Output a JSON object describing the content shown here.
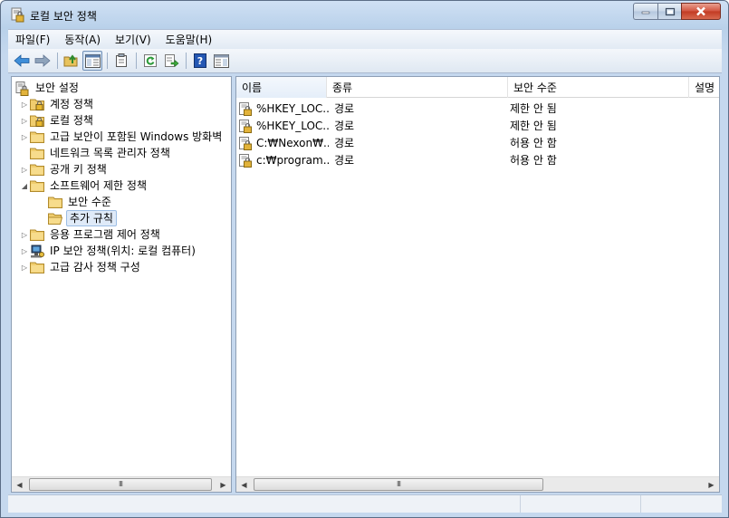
{
  "window": {
    "title": "로컬 보안 정책",
    "icon": "security-policy-icon"
  },
  "menu": [
    "파일(F)",
    "동작(A)",
    "보기(V)",
    "도움말(H)"
  ],
  "toolbar": {
    "buttons": [
      "back-arrow-icon",
      "forward-arrow-icon",
      "up-folder-icon",
      "show-hide-tree-icon",
      "properties-icon",
      "refresh-icon",
      "export-list-icon",
      "help-icon",
      "show-hide-action-pane-icon"
    ]
  },
  "tree": {
    "root": "보안 설정",
    "items": [
      {
        "label": "계정 정책",
        "expander": "▷",
        "icon": "lock-folder-icon"
      },
      {
        "label": "로컬 정책",
        "expander": "▷",
        "icon": "lock-folder-icon"
      },
      {
        "label": "고급 보안이 포함된 Windows 방화벽",
        "expander": "▷",
        "icon": "folder-icon"
      },
      {
        "label": "네트워크 목록 관리자 정책",
        "expander": "",
        "icon": "folder-icon"
      },
      {
        "label": "공개 키 정책",
        "expander": "▷",
        "icon": "folder-icon"
      },
      {
        "label": "소프트웨어 제한 정책",
        "expander": "◢",
        "icon": "folder-icon"
      },
      {
        "label": "보안 수준",
        "expander": "",
        "icon": "folder-icon"
      },
      {
        "label": "추가 규칙",
        "expander": "",
        "icon": "folder-open-icon",
        "selected": true
      },
      {
        "label": "응용 프로그램 제어 정책",
        "expander": "▷",
        "icon": "folder-icon"
      },
      {
        "label": "IP 보안 정책(위치: 로컬 컴퓨터)",
        "expander": "▷",
        "icon": "network-policy-icon"
      },
      {
        "label": "고급 감사 정책 구성",
        "expander": "▷",
        "icon": "folder-icon"
      }
    ]
  },
  "list": {
    "columns": [
      "이름",
      "종류",
      "보안 수준",
      "설명"
    ],
    "rows": [
      {
        "name": "%HKEY_LOC...",
        "type": "경로",
        "level": "제한 안 됨"
      },
      {
        "name": "%HKEY_LOC...",
        "type": "경로",
        "level": "제한 안 됨"
      },
      {
        "name": "C:₩Nexon₩...",
        "type": "경로",
        "level": "허용 안 함"
      },
      {
        "name": "c:₩program...",
        "type": "경로",
        "level": "허용 안 함"
      }
    ]
  },
  "scrollbar": {
    "grip": "III"
  }
}
